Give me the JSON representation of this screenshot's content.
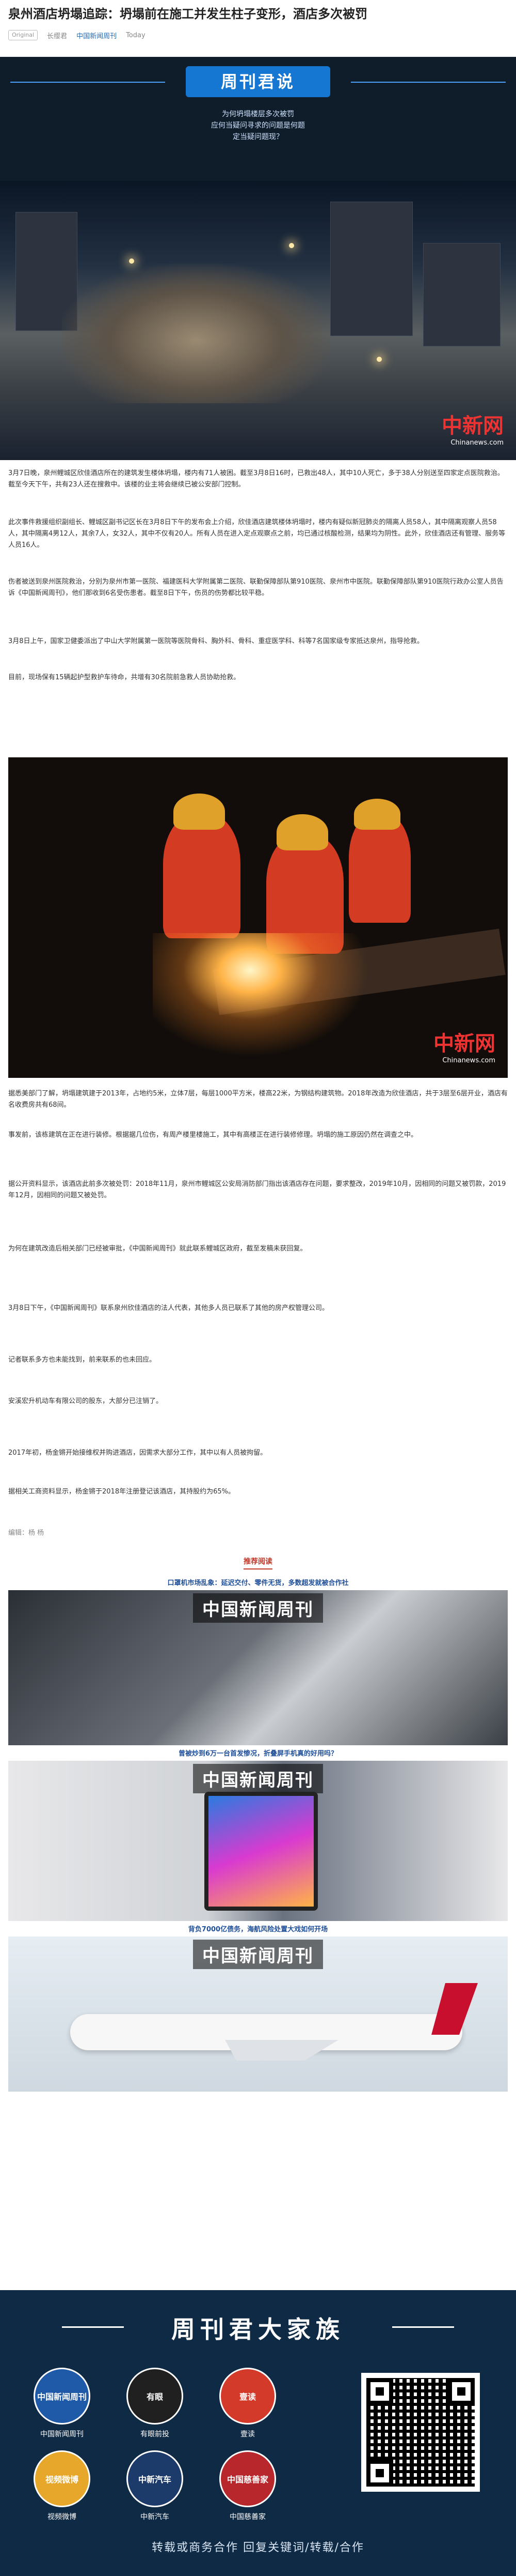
{
  "article": {
    "title": "泉州酒店坍塌追踪：坍塌前在施工并发生柱子变形，酒店多次被罚",
    "badge": "Original",
    "author": "长缨君",
    "account": "中国新闻周刊",
    "date": "Today"
  },
  "banner": {
    "title": "周刊君说",
    "lines": [
      "为何坍塌楼层多次被罚",
      "应何当疑问寻求的问题是何题",
      "定当疑问题现？"
    ]
  },
  "photo1": {
    "watermark": "中新网",
    "watermark_sub": "Chinanews.com"
  },
  "paragraphs": {
    "p1": "3月7日晚，泉州鲤城区欣佳酒店所在的建筑发生楼体坍塌，楼内有71人被困。截至3月8日16时，已救出48人，其中10人死亡，多于38人分别送至四家定点医院救治。截至今天下午，共有23人还在搜救中。该楼的业主将会继续已被公安部门控制。",
    "p2": "此次事件救援组织副组长、鲤城区副书记区长在3月8日下午的发布会上介绍，欣佳酒店建筑楼体坍塌时，楼内有疑似新冠肺炎的隔离人员58人，其中隔离观察人员58人，其中隔离4男12人，其余7人，女32人，其中不仅有20人。所有人员在进入定点观察点之前，均已通过核酸检测，结果均为阴性。此外，欣佳酒店还有管理、服务等人员16人。",
    "p3": "伤者被送到泉州医院救治，分别为泉州市第一医院、福建医科大学附属第二医院、联勤保障部队第910医院、泉州市中医院。联勤保障部队第910医院行政办公室人员告诉《中国新闻周刊》，他们那收到6名受伤患者。截至8日下午，伤员的伤势都比较平稳。",
    "p4": "3月8日上午，国家卫健委派出了中山大学附属第一医院等医院骨科、胸外科、骨科、重症医学科、科等7名国家级专家抵达泉州，指导抢救。",
    "p5": "目前，现场保有15辆起护型救护车待命，共增有30名院前急救人员协助抢救。",
    "p6": "据悉美部门了解，坍塌建筑建于2013年，占地约5米，立体7层，每层1000平方米，楼高22米，为钢结构建筑物。2018年改造为欣佳酒店，共于3层至6层开业，酒店有名收费房共有68间。",
    "p7": "事发前，该栋建筑在正在进行装修。根据据几位伤，有周产楼里楼施工，其中有高楼正在进行装修修理。坍塌的施工原因仍然在调查之中。",
    "p8": "据公开资料显示，该酒店此前多次被处罚：2018年11月，泉州市鲤城区公安局消防部门指出该酒店存在问题，要求整改，2019年10月，因相同的问题又被罚款，2019年12月，因相同的问题又被处罚。",
    "p9": "为何在建筑改造后相关部门已经被审批，《中国新闻周刊》就此联系鲤城区政府，截至发稿未获回复。",
    "p10": "3月8日下午，《中国新闻周刊》联系泉州欣佳酒店的法人代表，其他多人员已联系了其他的房产权管理公司。",
    "p11": "记者联系多方也未能找到，前来联系的也未回应。",
    "p12": "安溪宏升机动车有限公司的股东，大部分已注销了。",
    "p13": "2017年初，杨金锵开始接维权并购进酒店，因需求大部分工作，其中以有人员被拘留。",
    "p14": "据相关工商资料显示，杨金锵于2018年注册登记该酒店，其持股约为65%。",
    "editor": "编辑：杨 杨"
  },
  "photo2": {
    "watermark": "中新网",
    "watermark_sub": "Chinanews.com"
  },
  "recommend": {
    "label": "推荐阅读",
    "cards": [
      {
        "caption": "口罩机市场乱象：延迟交付、零件无货，多数超发就被合作社",
        "brand": "中国新闻周刊"
      },
      {
        "caption": "曾被炒到6万一台首发惨况，折叠屏手机真的好用吗？",
        "brand": "中国新闻周刊"
      },
      {
        "caption": "背负7000亿债务，海航风险处置大戏如何开场",
        "brand": "中国新闻周刊"
      }
    ]
  },
  "footer": {
    "heading": "周刊君大家族",
    "tiles": [
      {
        "name": "中国新闻周刊",
        "label": "中国新闻周刊",
        "color": "#1e5aa8"
      },
      {
        "name": "有眼",
        "label": "有眼前投",
        "color": "#202020"
      },
      {
        "name": "壹读",
        "label": "壹读",
        "color": "#d43a2a"
      },
      {
        "name": "视频微博",
        "label": "视频微博",
        "color": "#e7a72a"
      },
      {
        "name": "中新汽车",
        "label": "中新汽车",
        "color": "#1d3b6a"
      },
      {
        "name": "中国慈善家",
        "label": "中国慈善家",
        "color": "#b7272b"
      }
    ],
    "bottom_text": "转载或商务合作 回复关键词/转载/合作"
  }
}
